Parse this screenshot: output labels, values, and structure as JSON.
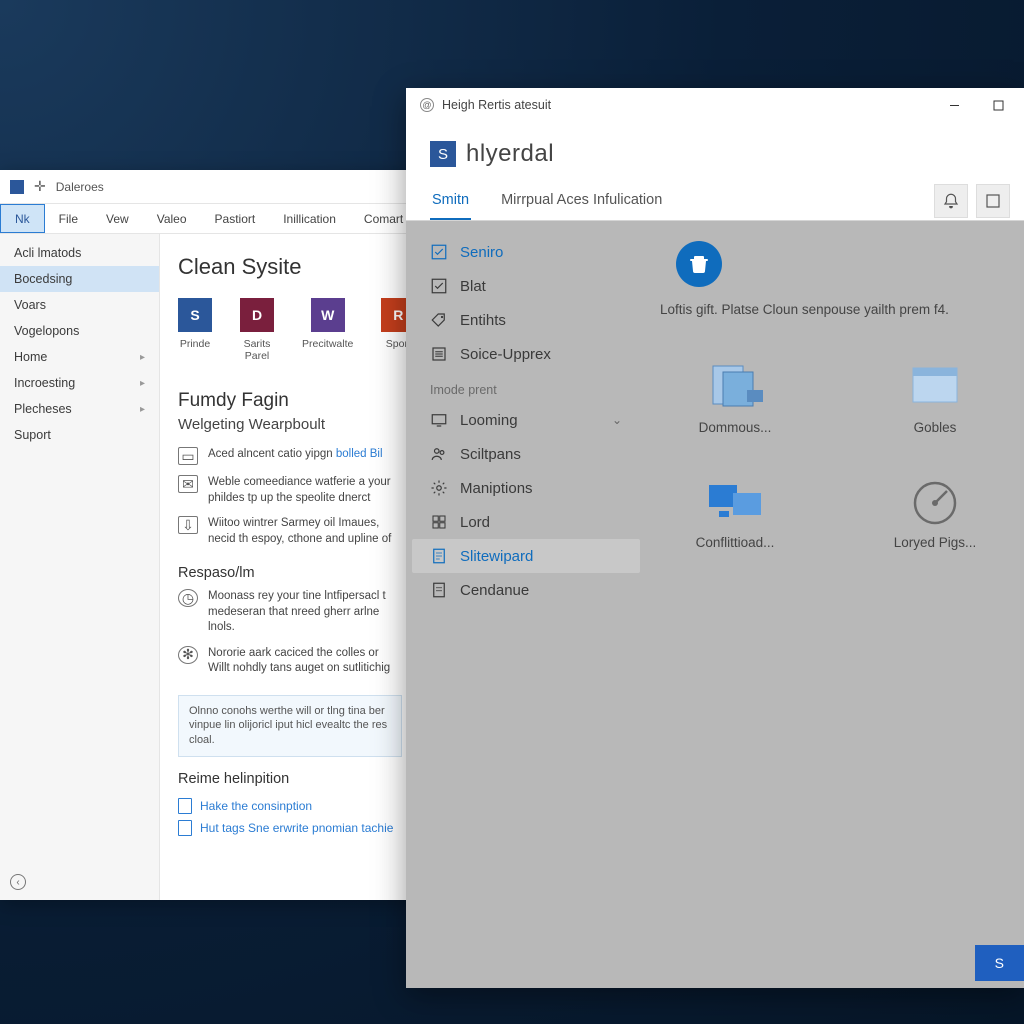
{
  "back": {
    "titlebar": {
      "label": "Daleroes"
    },
    "menubar": [
      "Nk",
      "File",
      "Vew",
      "Valeo",
      "Pastiort",
      "Inillication",
      "Comart"
    ],
    "menubar_active_index": 0,
    "sidebar": {
      "items": [
        {
          "label": "Acli lmatods",
          "expandable": false
        },
        {
          "label": "Bocedsing",
          "expandable": false,
          "selected": true
        },
        {
          "label": "Voars",
          "expandable": false
        },
        {
          "label": "Vogelopons",
          "expandable": false
        },
        {
          "label": "Home",
          "expandable": true
        },
        {
          "label": "Incroesting",
          "expandable": true
        },
        {
          "label": "Plecheses",
          "expandable": true
        },
        {
          "label": "Suport",
          "expandable": false
        }
      ]
    },
    "content": {
      "heading": "Clean Sysite",
      "apps": [
        {
          "label": "Prinde",
          "letter": "S",
          "color": "#2b579a"
        },
        {
          "label": "Sarits Parel",
          "letter": "D",
          "color": "#7a1f3d"
        },
        {
          "label": "Precitwalte",
          "letter": "W",
          "color": "#5b3e8f"
        },
        {
          "label": "Sport",
          "letter": "R",
          "color": "#c43e1c"
        }
      ],
      "section1_title": "Fumdy Fagin",
      "section1_sub": "Welgeting Wearpboult",
      "info_items": [
        {
          "text_pre": "Aced alncent catio yipgn ",
          "link": "bolled Bil"
        },
        {
          "text_pre": "Weble comeediance watferie a your phildes tp up the speolite dnerct"
        },
        {
          "text_pre": "Wiitoo wintrer Sarmey oil Imaues, necid th espoy, cthone and upline of"
        }
      ],
      "section2_title": "Respaso/lm",
      "resp_items": [
        "Moonass rey your tine lntfipersacl t medeseran that nreed gherr arlne lnols.",
        "Nororie aark caciced the colles or Willt nohdly tans auget on sutlitichig"
      ],
      "callout": "Olnno conohs werthe will or tlng tina ber vinpue lin olijoricl iput hicl evealtc the res cloal.",
      "section3_title": "Reime helinpition",
      "links": [
        "Hake the consinption",
        "Hut tags Sne erwrite pnomian tachie"
      ]
    }
  },
  "front": {
    "titlebar": {
      "title": "Heigh Rertis atesuit"
    },
    "brand": {
      "letter": "S",
      "name": "hlyerdal"
    },
    "tabs": {
      "items": [
        "Smitn",
        "Mirrpual Aces Infulication"
      ],
      "active_index": 0
    },
    "nav": {
      "top_items": [
        {
          "label": "Seniro",
          "active": true,
          "icon": "checkbox"
        },
        {
          "label": "Blat",
          "icon": "checkbox-alt"
        },
        {
          "label": "Entihts",
          "icon": "tag"
        },
        {
          "label": "Soice-Upprex",
          "icon": "list"
        }
      ],
      "group_label": "Imode prent",
      "group_items": [
        {
          "label": "Looming",
          "icon": "screen",
          "expandable": true
        },
        {
          "label": "Sciltpans",
          "icon": "people"
        },
        {
          "label": "Maniptions",
          "icon": "gear"
        },
        {
          "label": "Lord",
          "icon": "grid"
        },
        {
          "label": "Slitewipard",
          "icon": "doc",
          "selected": true
        },
        {
          "label": "Cendanue",
          "icon": "doc-alt"
        }
      ]
    },
    "main": {
      "feature_desc": "Loftis gift. Platse Cloun senpouse yailth prem f4.",
      "tiles": [
        {
          "label": "Dommous...",
          "graphic": "docs"
        },
        {
          "label": "Gobles",
          "graphic": "window"
        },
        {
          "label": "Conflittioad...",
          "graphic": "screens"
        },
        {
          "label": "Loryed Pigs...",
          "graphic": "gauge"
        }
      ]
    },
    "footer_button": "S"
  }
}
